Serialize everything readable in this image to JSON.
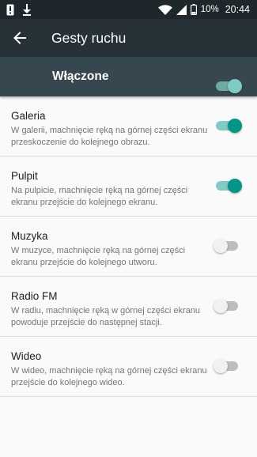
{
  "status_bar": {
    "battery_percent": "10%",
    "time": "20:44",
    "icons": [
      "notification-alert-icon",
      "download-icon",
      "wifi-icon",
      "signal-icon",
      "battery-icon"
    ]
  },
  "app_bar": {
    "title": "Gesty ruchu",
    "back_icon": "arrow-back-icon"
  },
  "master_switch": {
    "label": "Włączone",
    "enabled": true
  },
  "items": [
    {
      "title": "Galeria",
      "description": "W galerii, machnięcie ręką na górnej części ekranu przeskoczenie do kolejnego obrazu.",
      "enabled": true
    },
    {
      "title": "Pulpit",
      "description": "Na pulpicie, machnięcie ręką na górnej części ekranu przejście do kolejnego ekranu.",
      "enabled": true
    },
    {
      "title": "Muzyka",
      "description": "W muzyce, machnięcie ręką na górnej części ekranu przejście do kolejnego utworu.",
      "enabled": false
    },
    {
      "title": "Radio FM",
      "description": "W radiu, machnięcie ręką w górnej części ekranu powoduje przejście do następnej stacji.",
      "enabled": false
    },
    {
      "title": "Wideo",
      "description": "W wideo, machnięcie ręką na górnej części ekranu przejście do kolejnego wideo.",
      "enabled": false
    }
  ],
  "colors": {
    "status_bar": "#1e272b",
    "app_bar": "#263238",
    "master_bar": "#37474f",
    "accent": "#009688",
    "accent_track": "#80cbc4"
  }
}
